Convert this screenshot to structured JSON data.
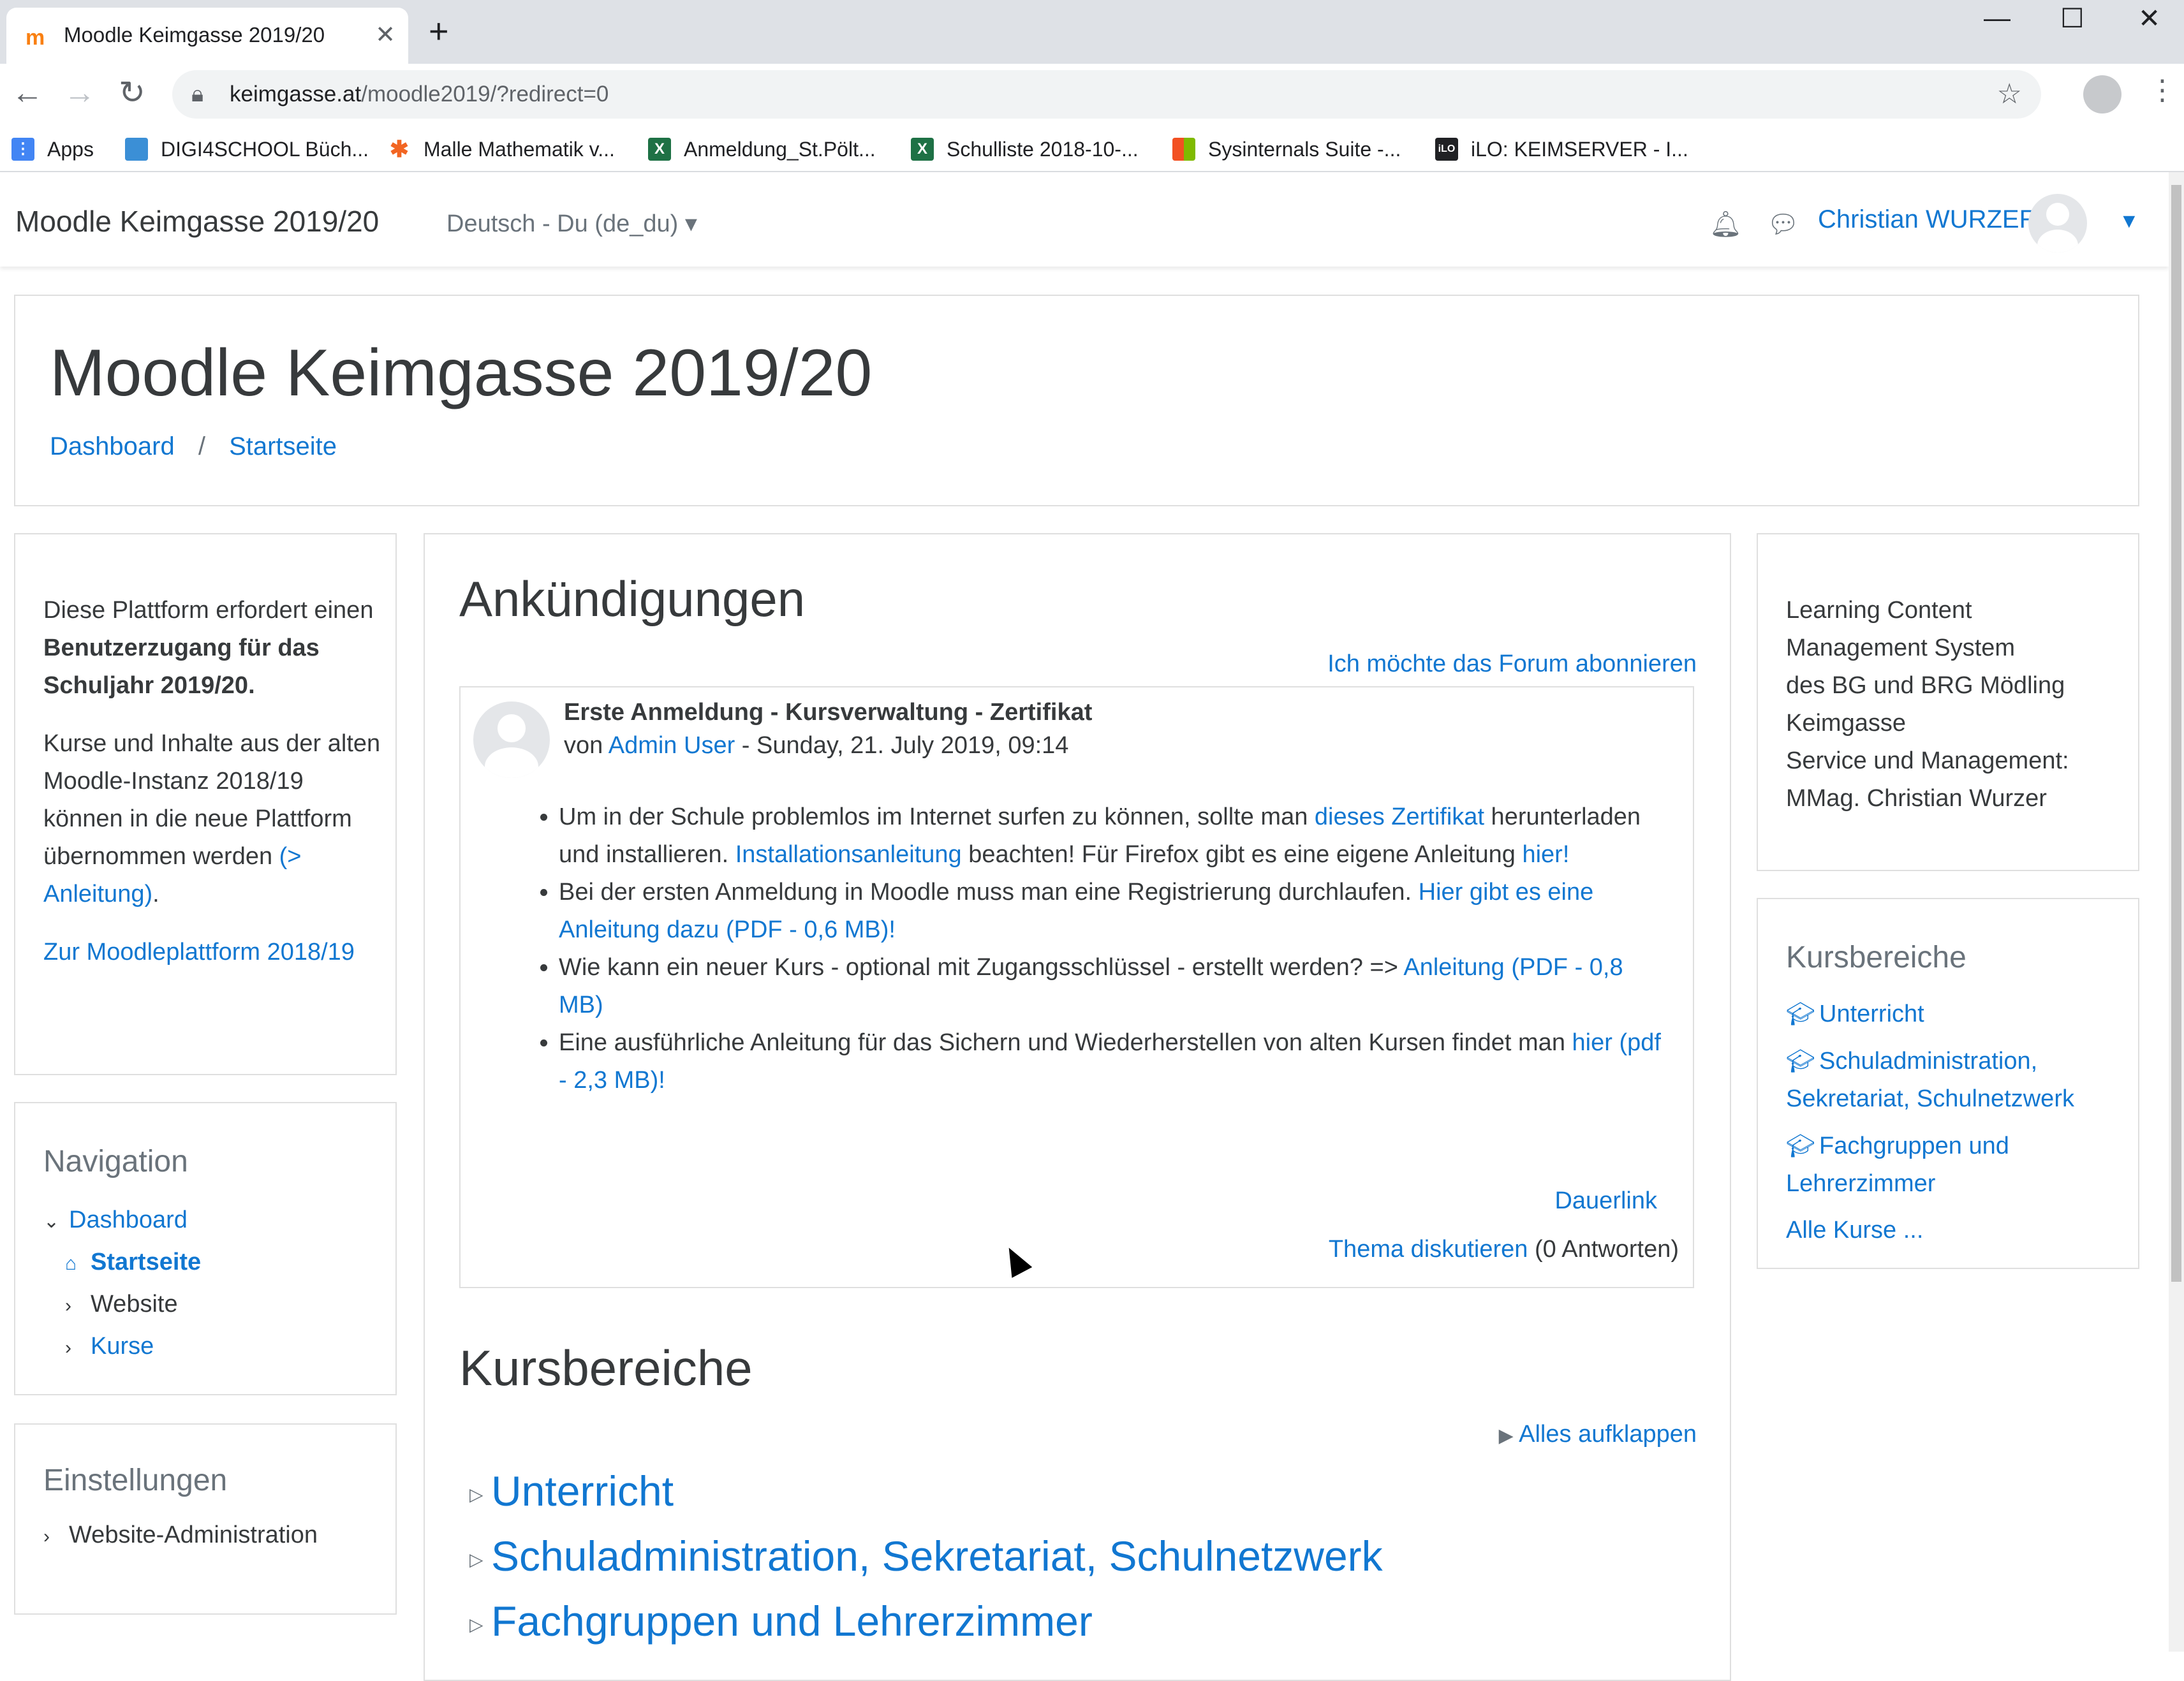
{
  "browser": {
    "tab_title": "Moodle Keimgasse 2019/20",
    "tab_close": "✕",
    "new_tab": "+",
    "url_host": "keimgasse.at",
    "url_path": "/moodle2019/?redirect=0",
    "bookmarks": [
      {
        "label": "Apps",
        "icon": "apps-grid-icon",
        "color": "#ea4335"
      },
      {
        "label": "DIGI4SCHOOL Büch...",
        "icon": "digi4school-icon",
        "color": "#3b8fd6"
      },
      {
        "label": "Malle Mathematik v...",
        "icon": "malle-icon",
        "color": "#f26522"
      },
      {
        "label": "Anmeldung_St.Pölt...",
        "icon": "excel-icon",
        "color": "#1e7145"
      },
      {
        "label": "Schulliste 2018-10-...",
        "icon": "excel-icon",
        "color": "#1e7145"
      },
      {
        "label": "Sysinternals Suite -...",
        "icon": "microsoft-icon",
        "color": "#f25022"
      },
      {
        "label": "iLO: KEIMSERVER - I...",
        "icon": "ilo-icon",
        "color": "#202124"
      }
    ]
  },
  "navbar": {
    "brand": "Moodle Keimgasse 2019/20",
    "language": "Deutsch - Du (de_du)",
    "user_name": "Christian WURZER"
  },
  "header": {
    "title": "Moodle Keimgasse 2019/20",
    "breadcrumb": [
      "Dashboard",
      "Startseite"
    ]
  },
  "left_block": {
    "p1_pre": "Diese Plattform erfordert einen ",
    "p1_bold": "Benutzerzugang für das Schuljahr 2019/20.",
    "p2_pre": "Kurse und Inhalte aus der alten Moodle-Instanz 2018/19 können in die neue Plattform übernommen werden ",
    "p2_link": "(> Anleitung)",
    "p2_post": ".",
    "p3_link": "Zur Moodleplattform 2018/19"
  },
  "navigation": {
    "title": "Navigation",
    "items": [
      {
        "label": "Dashboard",
        "arrow": "⌄"
      },
      {
        "label": "Startseite",
        "arrow": "⌂"
      },
      {
        "label": "Website",
        "arrow": "›"
      },
      {
        "label": "Kurse",
        "arrow": "›"
      }
    ]
  },
  "settings": {
    "title": "Einstellungen",
    "item": "Website-Administration"
  },
  "announcements": {
    "title": "Ankündigungen",
    "subscribe": "Ich möchte das Forum abonnieren",
    "subject": "Erste Anmeldung - Kursverwaltung - Zertifikat",
    "by": "von ",
    "author": "Admin User",
    "date": " - Sunday, 21. July 2019, 09:14",
    "li1_a": "Um in der Schule problemlos im Internet surfen zu können, sollte man ",
    "li1_link1": "dieses Zertifikat",
    "li1_b": " herunterladen und installieren. ",
    "li1_link2": "Installationsanleitung",
    "li1_c": " beachten! Für Firefox gibt es eine eigene Anleitung ",
    "li1_link3": "hier!",
    "li2_a": "Bei der ersten Anmeldung in Moodle muss man eine Registrierung durchlaufen. ",
    "li2_link": "Hier gibt es eine Anleitung dazu (PDF - 0,6 MB)!",
    "li3_a": "Wie kann ein neuer Kurs - optional mit Zugangsschlüssel - erstellt werden? => ",
    "li3_link": "Anleitung (PDF - 0,8 MB)",
    "li4_a": "Eine ausführliche Anleitung für das Sichern und Wiederherstellen von alten Kursen findet man ",
    "li4_link": "hier (pdf - 2,3 MB)!",
    "permalink": "Dauerlink",
    "discuss": "Thema diskutieren",
    "replies": " (0 Antworten)"
  },
  "course_categories_main": {
    "title": "Kursbereiche",
    "expand_all": "Alles aufklappen",
    "categories": [
      "Unterricht",
      "Schuladministration, Sekretariat, Schulnetzwerk",
      "Fachgruppen und Lehrerzimmer"
    ]
  },
  "right_block": {
    "lines": [
      "Learning Content",
      "Management System",
      "des BG und BRG Mödling",
      "Keimgasse",
      "Service und Management:",
      "MMag. Christian Wurzer"
    ]
  },
  "course_categories_block": {
    "title": "Kursbereiche",
    "items": [
      "Unterricht",
      "Schuladministration, Sekretariat, Schulnetzwerk",
      "Fachgruppen und Lehrerzimmer"
    ],
    "all_courses": "Alle Kurse ..."
  }
}
